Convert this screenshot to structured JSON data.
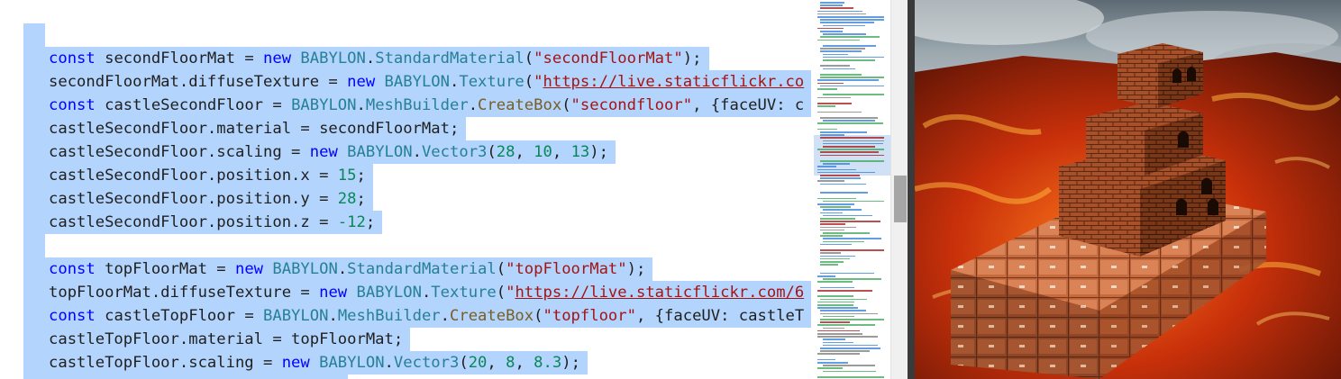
{
  "editor": {
    "lines": [
      {
        "indent": true,
        "tokens": [
          {
            "t": "const",
            "c": "kw"
          },
          {
            "t": " secondFloorMat = "
          },
          {
            "t": "new",
            "c": "kw"
          },
          {
            "t": " "
          },
          {
            "t": "BABYLON",
            "c": "cls"
          },
          {
            "t": "."
          },
          {
            "t": "StandardMaterial",
            "c": "cls"
          },
          {
            "t": "("
          },
          {
            "t": "\"secondFloorMat\"",
            "c": "str"
          },
          {
            "t": ");"
          }
        ]
      },
      {
        "indent": true,
        "tokens": [
          {
            "t": "secondFloorMat.diffuseTexture = "
          },
          {
            "t": "new",
            "c": "kw"
          },
          {
            "t": " "
          },
          {
            "t": "BABYLON",
            "c": "cls"
          },
          {
            "t": "."
          },
          {
            "t": "Texture",
            "c": "cls"
          },
          {
            "t": "("
          },
          {
            "t": "\"",
            "c": "str"
          },
          {
            "t": "https://live.staticflickr.co",
            "c": "url"
          }
        ]
      },
      {
        "indent": true,
        "tokens": [
          {
            "t": "const",
            "c": "kw"
          },
          {
            "t": " castleSecondFloor = "
          },
          {
            "t": "BABYLON",
            "c": "cls"
          },
          {
            "t": "."
          },
          {
            "t": "MeshBuilder",
            "c": "cls"
          },
          {
            "t": "."
          },
          {
            "t": "CreateBox",
            "c": "fn"
          },
          {
            "t": "("
          },
          {
            "t": "\"secondfloor\"",
            "c": "str"
          },
          {
            "t": ", {faceUV: c"
          }
        ]
      },
      {
        "indent": true,
        "tokens": [
          {
            "t": "castleSecondFloor.material = secondFloorMat;"
          }
        ]
      },
      {
        "indent": true,
        "tokens": [
          {
            "t": "castleSecondFloor.scaling = "
          },
          {
            "t": "new",
            "c": "kw"
          },
          {
            "t": " "
          },
          {
            "t": "BABYLON",
            "c": "cls"
          },
          {
            "t": "."
          },
          {
            "t": "Vector3",
            "c": "cls"
          },
          {
            "t": "("
          },
          {
            "t": "28",
            "c": "num"
          },
          {
            "t": ", "
          },
          {
            "t": "10",
            "c": "num"
          },
          {
            "t": ", "
          },
          {
            "t": "13",
            "c": "num"
          },
          {
            "t": ");"
          }
        ]
      },
      {
        "indent": true,
        "tokens": [
          {
            "t": "castleSecondFloor.position.x = "
          },
          {
            "t": "15",
            "c": "num"
          },
          {
            "t": ";"
          }
        ]
      },
      {
        "indent": true,
        "tokens": [
          {
            "t": "castleSecondFloor.position.y = "
          },
          {
            "t": "28",
            "c": "num"
          },
          {
            "t": ";"
          }
        ]
      },
      {
        "indent": true,
        "tokens": [
          {
            "t": "castleSecondFloor.position.z = "
          },
          {
            "t": "-12",
            "c": "num"
          },
          {
            "t": ";"
          }
        ]
      },
      {
        "indent": false,
        "tokens": []
      },
      {
        "indent": true,
        "tokens": [
          {
            "t": "const",
            "c": "kw"
          },
          {
            "t": " topFloorMat = "
          },
          {
            "t": "new",
            "c": "kw"
          },
          {
            "t": " "
          },
          {
            "t": "BABYLON",
            "c": "cls"
          },
          {
            "t": "."
          },
          {
            "t": "StandardMaterial",
            "c": "cls"
          },
          {
            "t": "("
          },
          {
            "t": "\"topFloorMat\"",
            "c": "str"
          },
          {
            "t": ");"
          }
        ]
      },
      {
        "indent": true,
        "tokens": [
          {
            "t": "topFloorMat.diffuseTexture = "
          },
          {
            "t": "new",
            "c": "kw"
          },
          {
            "t": " "
          },
          {
            "t": "BABYLON",
            "c": "cls"
          },
          {
            "t": "."
          },
          {
            "t": "Texture",
            "c": "cls"
          },
          {
            "t": "("
          },
          {
            "t": "\"",
            "c": "str"
          },
          {
            "t": "https://live.staticflickr.com/6",
            "c": "url"
          }
        ]
      },
      {
        "indent": true,
        "tokens": [
          {
            "t": "const",
            "c": "kw"
          },
          {
            "t": " castleTopFloor = "
          },
          {
            "t": "BABYLON",
            "c": "cls"
          },
          {
            "t": "."
          },
          {
            "t": "MeshBuilder",
            "c": "cls"
          },
          {
            "t": "."
          },
          {
            "t": "CreateBox",
            "c": "fn"
          },
          {
            "t": "("
          },
          {
            "t": "\"topfloor\"",
            "c": "str"
          },
          {
            "t": ", {faceUV: castleT"
          }
        ]
      },
      {
        "indent": true,
        "tokens": [
          {
            "t": "castleTopFloor.material = topFloorMat;"
          }
        ]
      },
      {
        "indent": true,
        "tokens": [
          {
            "t": "castleTopFloor.scaling = "
          },
          {
            "t": "new",
            "c": "kw"
          },
          {
            "t": " "
          },
          {
            "t": "BABYLON",
            "c": "cls"
          },
          {
            "t": "."
          },
          {
            "t": "Vector3",
            "c": "cls"
          },
          {
            "t": "("
          },
          {
            "t": "20",
            "c": "num"
          },
          {
            "t": ", "
          },
          {
            "t": "8",
            "c": "num"
          },
          {
            "t": ", "
          },
          {
            "t": "8.3",
            "c": "num"
          },
          {
            "t": ");"
          }
        ]
      }
    ]
  },
  "colors": {
    "selection": "#b3d4fc",
    "keyword": "#0000ff",
    "class": "#267f99",
    "function": "#795e26",
    "string": "#a31515",
    "number": "#098658"
  },
  "icons": [
    "minimap",
    "scrollbar",
    "babylon-render-canvas"
  ]
}
